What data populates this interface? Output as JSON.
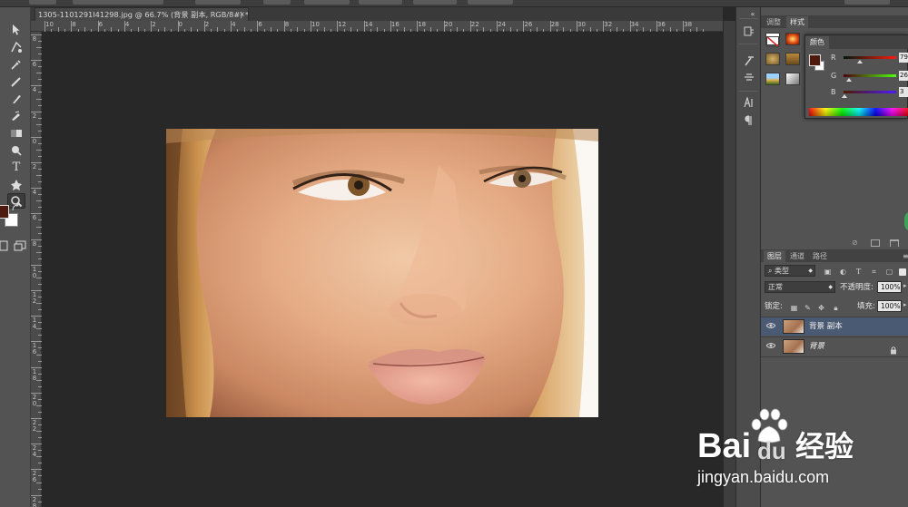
{
  "document": {
    "tab_title": "1305-1101291I41298.jpg @ 66.7% (背景 副本, RGB/8#) *",
    "close_glyph": "×"
  },
  "rulers": {
    "horizontal_labels": [
      "10",
      "8",
      "6",
      "4",
      "2",
      "0",
      "2",
      "4",
      "6",
      "8",
      "10",
      "12",
      "14",
      "16",
      "18",
      "20",
      "22",
      "24",
      "26",
      "28",
      "30",
      "32",
      "34",
      "36",
      "38"
    ],
    "vertical_labels": [
      "8",
      "6",
      "4",
      "2",
      "0",
      "2",
      "4",
      "6",
      "8",
      "1\n0",
      "1\n2",
      "1\n4",
      "1\n6",
      "1\n8",
      "2\n0",
      "2\n2",
      "2\n4",
      "2\n6",
      "2\n8"
    ]
  },
  "toolbar": {
    "tools": [
      "move-icon",
      "marquee-icon",
      "lasso-icon",
      "quick-select-icon",
      "crop-icon",
      "eyedropper-icon",
      "healing-brush-icon",
      "brush-icon",
      "clone-stamp-icon",
      "history-brush-icon",
      "eraser-icon",
      "gradient-icon",
      "blur-icon",
      "dodge-icon",
      "pen-icon",
      "type-icon",
      "path-select-icon",
      "shape-icon",
      "hand-icon",
      "zoom-icon"
    ],
    "type_glyph": "T",
    "foreground_color": "#4e1a0d",
    "background_color": "#ffffff"
  },
  "adjustments_panel": {
    "tabs": [
      "调整",
      "样式"
    ]
  },
  "color_panel": {
    "tab": "颜色",
    "channels": [
      {
        "label": "R",
        "value": "79",
        "gradient_from": "#001a0d",
        "gradient_to": "#ff1a0d",
        "level": 0.31
      },
      {
        "label": "G",
        "value": "26",
        "gradient_from": "#4e000d",
        "gradient_to": "#4eff0d",
        "level": 0.1
      },
      {
        "label": "B",
        "value": "3",
        "gradient_from": "#4e1a00",
        "gradient_to": "#4e1aff",
        "level": 0.01
      }
    ]
  },
  "layers_panel": {
    "tabs": [
      "图层",
      "通道",
      "路径"
    ],
    "filter_kind": "类型",
    "blend_mode": "正常",
    "opacity_label": "不透明度:",
    "opacity_value": "100%",
    "lock_label": "锁定:",
    "fill_label": "填充:",
    "fill_value": "100%",
    "layers": [
      {
        "name": "背景 副本",
        "selected": true,
        "locked": false
      },
      {
        "name": "背景",
        "selected": false,
        "locked": true
      }
    ]
  },
  "watermark": {
    "brand": "Bai",
    "brand_paw": "du",
    "product": "经验",
    "url": "jingyan.baidu.com"
  }
}
